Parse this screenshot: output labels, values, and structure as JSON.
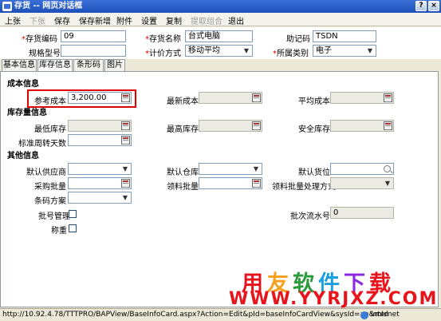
{
  "window": {
    "title": "存货 -- 网页对话框",
    "buttons": [
      "?",
      "×"
    ]
  },
  "toolbar": [
    {
      "label": "上张",
      "disabled": false
    },
    {
      "label": "下张",
      "disabled": true
    },
    {
      "label": "保存",
      "disabled": false
    },
    {
      "label": "保存新增",
      "disabled": false
    },
    {
      "label": "附件",
      "disabled": false
    },
    {
      "label": "设置",
      "disabled": false
    },
    {
      "label": "复制",
      "disabled": false
    },
    {
      "label": "提取组合",
      "disabled": true
    },
    {
      "label": "退出",
      "disabled": false
    }
  ],
  "header": {
    "code_label": "存货编码",
    "code_value": "09",
    "name_label": "存货名称",
    "name_value": "台式电脑",
    "mnemonic_label": "助记码",
    "mnemonic_value": "TSDN",
    "spec_label": "规格型号",
    "spec_value": "",
    "pricing_label": "计价方式",
    "pricing_value": "移动平均",
    "category_label": "所属类别",
    "category_value": "电子",
    "required_mark": "*"
  },
  "tabs": [
    "基本信息",
    "库存信息",
    "条形码",
    "图片"
  ],
  "cost": {
    "section": "成本信息",
    "ref_cost_label": "参考成本",
    "ref_cost_value": "3,200.00",
    "latest_cost_label": "最新成本",
    "latest_cost_value": "",
    "avg_cost_label": "平均成本",
    "avg_cost_value": ""
  },
  "stock": {
    "section": "库存量信息",
    "min_label": "最低库存",
    "max_label": "最高库存",
    "safety_label": "安全库存",
    "turnover_label": "标准周转天数"
  },
  "other": {
    "section": "其他信息",
    "supplier_label": "默认供应商",
    "warehouse_label": "默认仓库",
    "location_label": "默认货位",
    "purchase_batch_label": "采购批量",
    "issue_batch_label": "领料批量",
    "issue_method_label": "领料批量处理方式",
    "barcode_label": "条码方案",
    "batch_mgmt_label": "批号管理",
    "serial_label": "批次流水号",
    "serial_value": "0",
    "weigh_label": "称重"
  },
  "watermark": {
    "line1": "用友软件下载",
    "line2": "WWW.YYRJXZ.COM",
    "colors": [
      "#e8141c",
      "#f7a01a",
      "#2a9a3a",
      "#1aa0e0",
      "#8a2be2",
      "#e8141c"
    ]
  },
  "status": {
    "url": "http://10.92.4.78/TTTPRO/BAPView/BaseInfoCard.aspx?Action=Edit&pId=baseInfoCardView&sysId=aa&mId",
    "zone": "Internet"
  }
}
